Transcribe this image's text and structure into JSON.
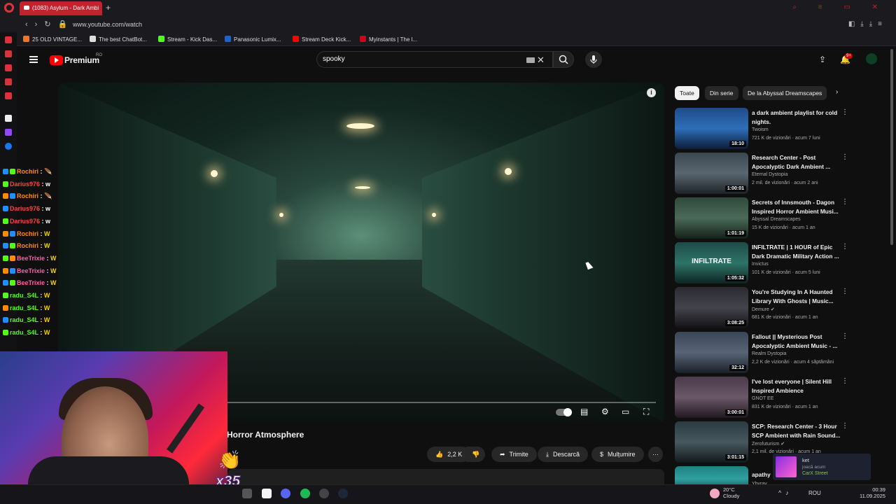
{
  "browser": {
    "tab_title": "(1083) Asylum - Dark Ambi",
    "new_tab": "+",
    "url": "www.youtube.com/watch",
    "bookmarks": [
      "25 OLD VINTAGE...",
      "The best ChatBot...",
      "Stream - Kick Das...",
      "Panasonic Lumix...",
      "Stream Deck Kick...",
      "Myinstants | The l..."
    ],
    "bookmark_colors": [
      "#e8772e",
      "#dddddd",
      "#53fc18",
      "#1e64c8",
      "#ff0000",
      "#d0021b"
    ]
  },
  "header": {
    "brand": "Premium",
    "region": "RO",
    "search_value": "spooky",
    "notification_count": "9+"
  },
  "player": {
    "info": "i",
    "title": "Horror Atmosphere"
  },
  "actions": {
    "likes": "2,2 K",
    "share": "Trimite",
    "download": "Descarcă",
    "thanks": "Mulțumire",
    "more": "···"
  },
  "chips": [
    "Toate",
    "Din serie",
    "De la Abyssal Dreamscapes"
  ],
  "recommendations": [
    {
      "title": "a dark ambient playlist for cold nights.",
      "channel": "Twoism",
      "meta": "721 K de vizionări · acum 7 luni",
      "duration": "18:10",
      "thumb": "linear-gradient(180deg,#1f4a8a 0%,#2e6fb8 50%,#0c1c38 100%)"
    },
    {
      "title": "Research Center - Post Apocalyptic Dark Ambient ...",
      "channel": "Eternal Dystopia",
      "meta": "2 mil. de vizionări · acum 2 ani",
      "duration": "1:00:01",
      "thumb": "linear-gradient(180deg,#3a4650 0%,#5a6670 50%,#1e2328 100%)"
    },
    {
      "title": "Secrets of Innsmouth - Dagon Inspired Horror Ambient Musi...",
      "channel": "Abyssal Dreamscapes",
      "meta": "15 K de vizionări · acum 1 an",
      "duration": "1:01:19",
      "thumb": "linear-gradient(180deg,#304a3c 0%,#4a6a58 50%,#142018 100%)"
    },
    {
      "title": "INFILTRATE | 1 HOUR of Epic Dark Dramatic Military Action ...",
      "channel": "Invictus",
      "meta": "101 K de vizionări · acum 5 luni",
      "duration": "1:05:32",
      "thumb": "linear-gradient(180deg,#1e4a46 0%,#2e7468 50%,#0e2422 100%)",
      "overlay": "INFILTRATE"
    },
    {
      "title": "You're Studying In A Haunted Library With Ghosts | Music...",
      "channel": "Demure ✔",
      "meta": "681 K de vizionări · acum 1 an",
      "duration": "3:08:25",
      "thumb": "linear-gradient(180deg,#2a2a30 0%,#44444c 50%,#121216 100%)"
    },
    {
      "title": "Fallout || Mysterious Post Apocalyptic Ambient Music - ...",
      "channel": "Realm Dystopia",
      "meta": "2,2 K de vizionări · acum 4 săptămâni",
      "duration": "32:12",
      "thumb": "linear-gradient(180deg,#3a4658 0%,#586476 50%,#1a2028 100%)"
    },
    {
      "title": "I've lost everyone | Silent Hill Inspired Ambience",
      "channel": "GNOT EE",
      "meta": "831 K de vizionări · acum 1 an",
      "duration": "3:00:01",
      "thumb": "linear-gradient(180deg,#4a3a4a 0%,#6a5868 50%,#201820 100%)"
    },
    {
      "title": "SCP: Research Center - 3 Hour SCP Ambient with Rain Sound...",
      "channel": "Zerofuturism ✔",
      "meta": "2,1 mil. de vizionări · acum 1 an",
      "duration": "3:01:15",
      "thumb": "linear-gradient(180deg,#2a3a40 0%,#46585e 50%,#12181c 100%)"
    },
    {
      "title": "apathy",
      "channel": "Ybyrav",
      "meta": "",
      "duration": "",
      "thumb": "linear-gradient(180deg,#1e8080 0%,#30a0a0 50%,#104848 100%)"
    }
  ],
  "chat": [
    {
      "user": "Rochiri",
      "color": "#ff8c00",
      "msg": "",
      "emote": "🪶"
    },
    {
      "user": "Darius976",
      "color": "#ff4040",
      "msg": "w",
      "emote": ""
    },
    {
      "user": "Rochiri",
      "color": "#ff8c00",
      "msg": "",
      "emote": "🪶"
    },
    {
      "user": "Darius976",
      "color": "#ff4040",
      "msg": "w",
      "emote": ""
    },
    {
      "user": "Darius976",
      "color": "#ff4040",
      "msg": "w",
      "emote": ""
    },
    {
      "user": "Rochiri",
      "color": "#ff8c00",
      "msg": "",
      "emote": "W"
    },
    {
      "user": "Rochiri",
      "color": "#ff8c00",
      "msg": "",
      "emote": "W"
    },
    {
      "user": "BeeTrixie",
      "color": "#ff5ba8",
      "msg": "",
      "emote": "W"
    },
    {
      "user": "BeeTrixie",
      "color": "#ff5ba8",
      "msg": "",
      "emote": "W"
    },
    {
      "user": "BeeTrixie",
      "color": "#ff5ba8",
      "msg": "",
      "emote": "W"
    },
    {
      "user": "radu_S4L",
      "color": "#53fc18",
      "msg": "",
      "emote": "W"
    },
    {
      "user": "radu_S4L",
      "color": "#53fc18",
      "msg": "",
      "emote": "W"
    },
    {
      "user": "radu_S4L",
      "color": "#53fc18",
      "msg": "",
      "emote": "W"
    },
    {
      "user": "radu_S4L",
      "color": "#53fc18",
      "msg": "",
      "emote": "W"
    }
  ],
  "overlay": {
    "clap_count": "x35"
  },
  "toast": {
    "name": "ket",
    "activity": "joacă acum",
    "game": "CarX Street"
  },
  "taskbar": {
    "weather_temp": "20°C",
    "weather_desc": "Cloudy",
    "lang": "ROU",
    "time": "00:39",
    "date": "11.09.2025"
  }
}
